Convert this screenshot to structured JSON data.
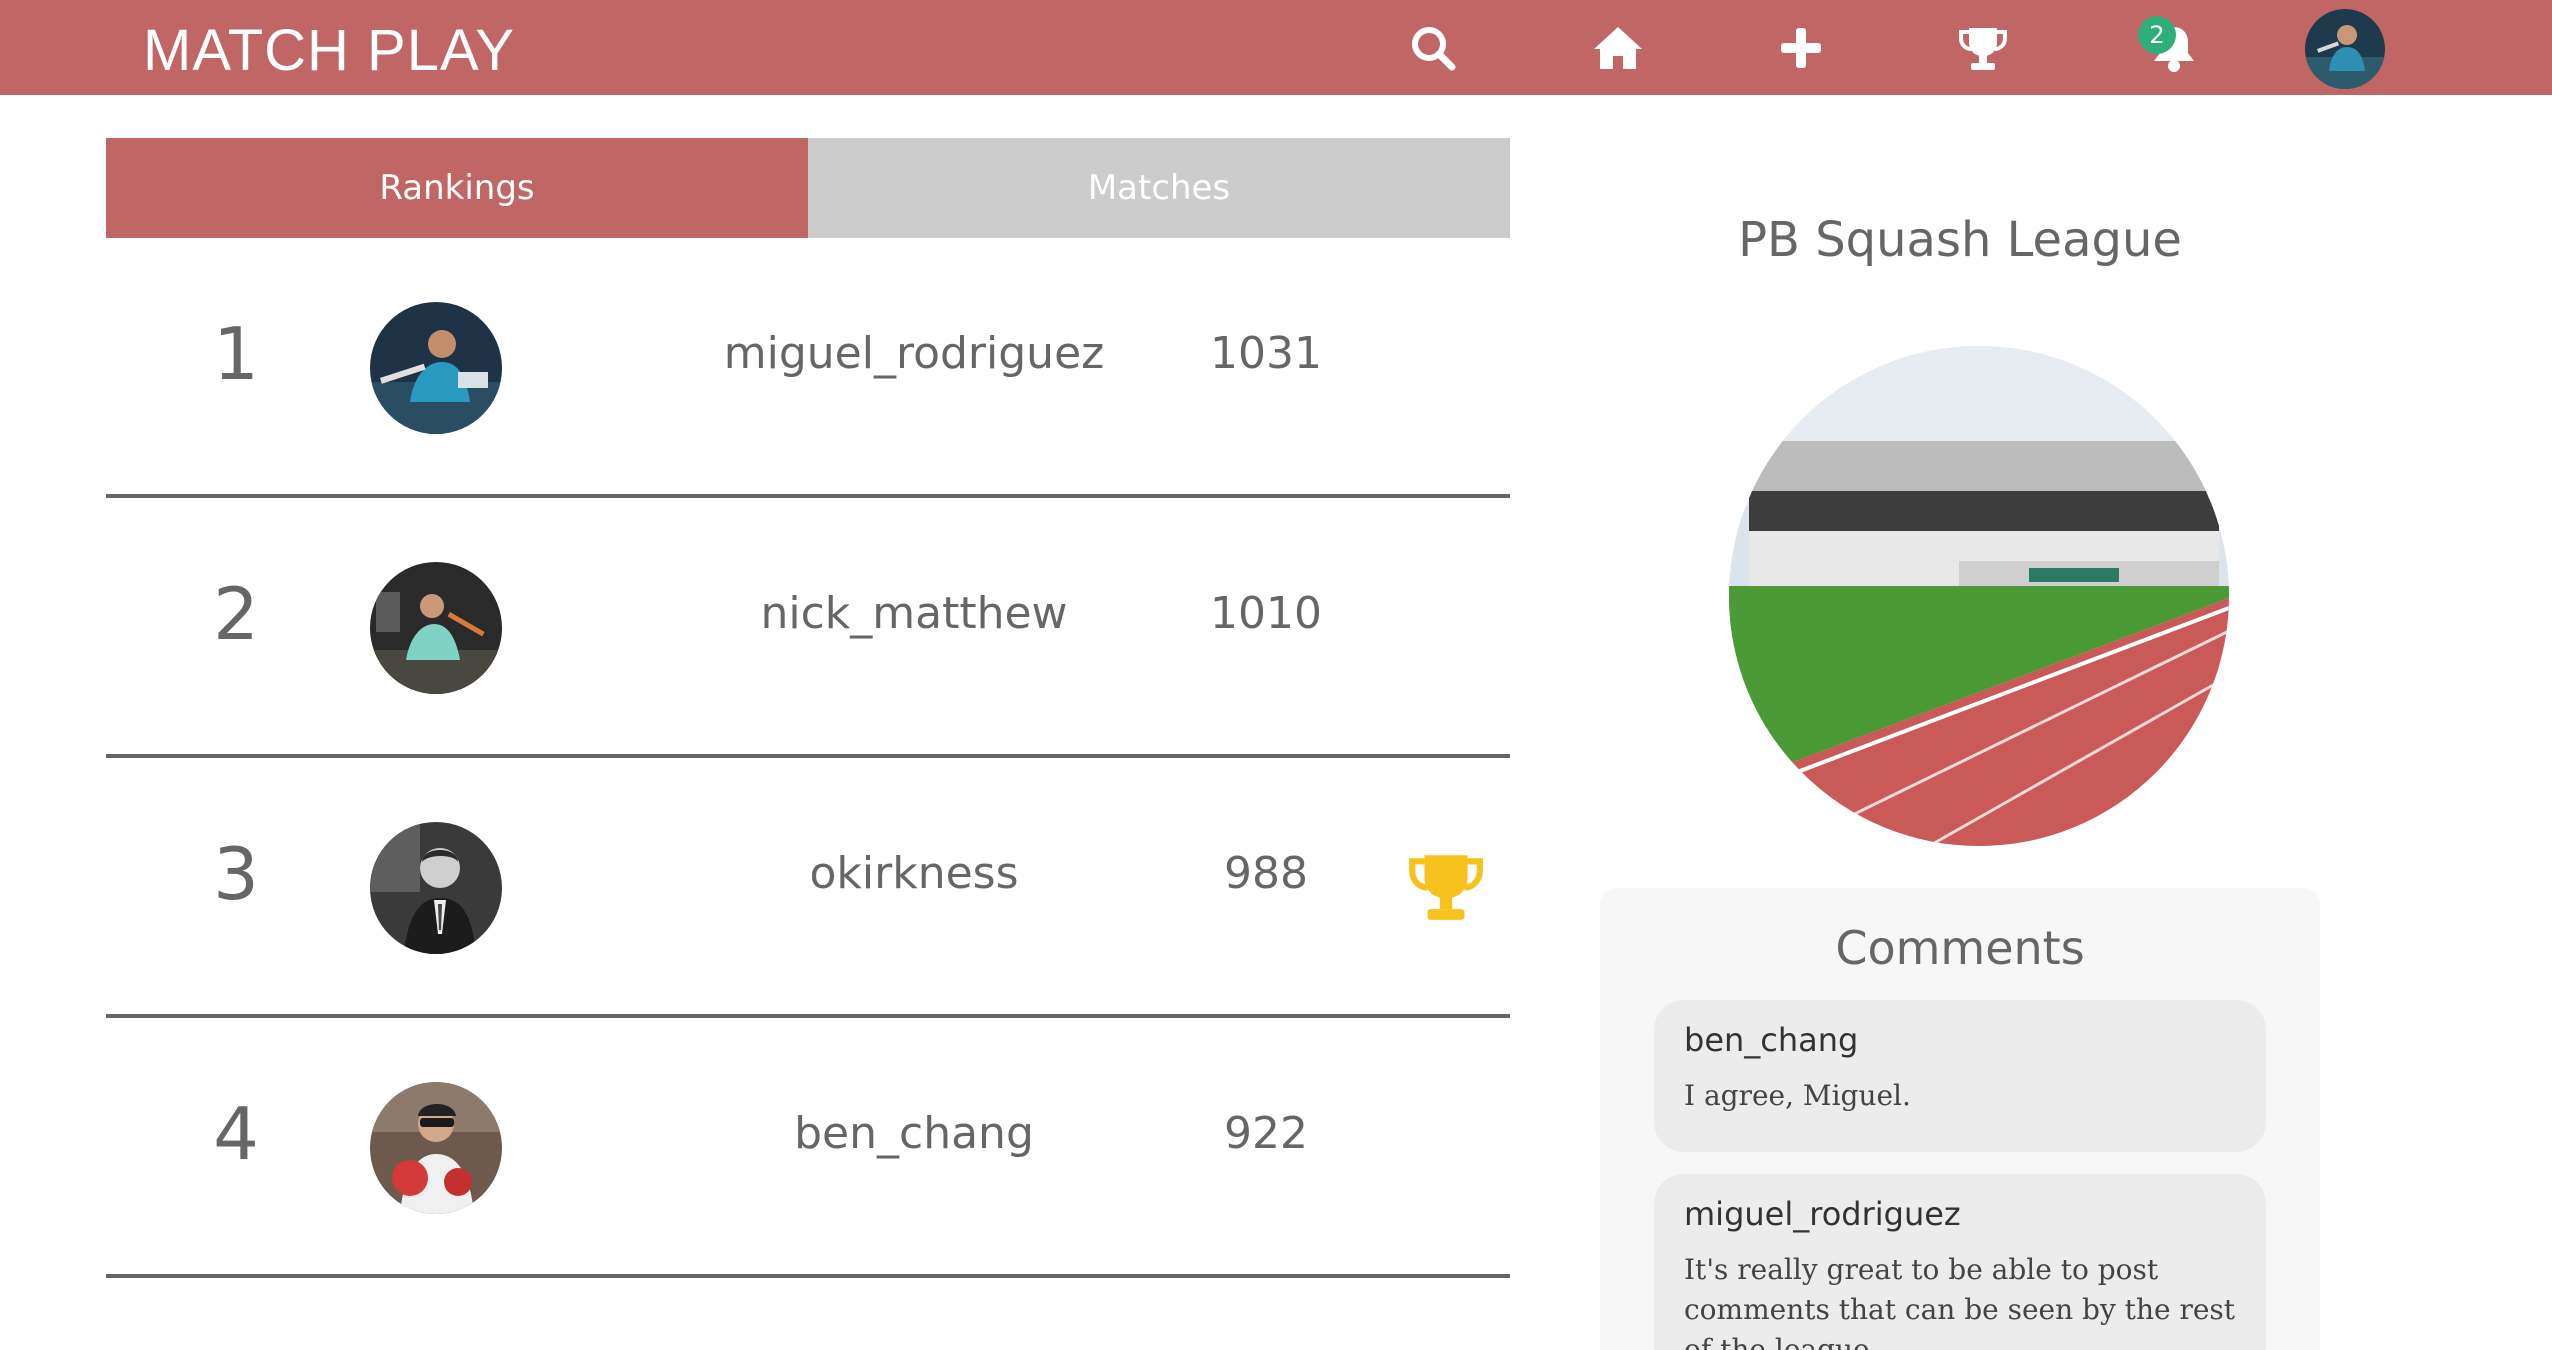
{
  "app": {
    "brand": "MATCH PLAY"
  },
  "nav": {
    "icons": [
      "search-icon",
      "home-icon",
      "plus-icon",
      "trophy-icon",
      "bell-icon"
    ],
    "notification_count": "2"
  },
  "tabs": [
    {
      "label": "Rankings",
      "active": true
    },
    {
      "label": "Matches",
      "active": false
    }
  ],
  "rankings": [
    {
      "rank": "1",
      "username": "miguel_rodriguez",
      "score": "1031",
      "trophy": false
    },
    {
      "rank": "2",
      "username": "nick_matthew",
      "score": "1010",
      "trophy": false
    },
    {
      "rank": "3",
      "username": "okirkness",
      "score": "988",
      "trophy": true
    },
    {
      "rank": "4",
      "username": "ben_chang",
      "score": "922",
      "trophy": false
    }
  ],
  "league": {
    "name": "PB Squash League"
  },
  "comments": {
    "title": "Comments",
    "items": [
      {
        "author": "ben_chang",
        "text": "I agree, Miguel."
      },
      {
        "author": "miguel_rodriguez",
        "text": "It's really great to be able to post comments that can be seen by the rest of the league."
      }
    ]
  },
  "colors": {
    "brand": "#c06766",
    "tab_inactive": "#cccccc",
    "badge": "#2eae79",
    "trophy": "#f7c21e"
  }
}
